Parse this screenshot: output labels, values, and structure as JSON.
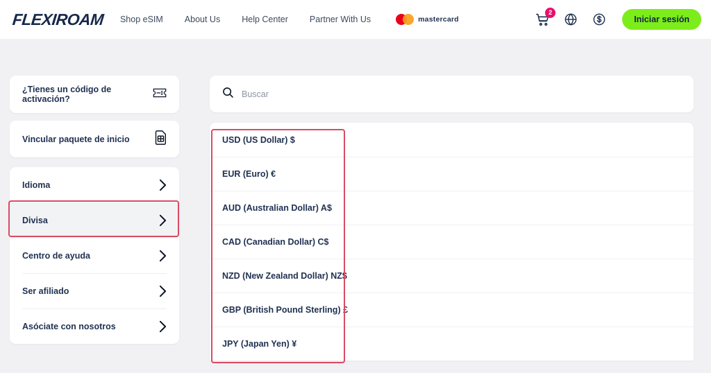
{
  "brand": {
    "logo_text": "FLEXIROAM",
    "accent_green": "#7ced1a",
    "navy": "#1f3050",
    "badge_pink": "#ec0d6e",
    "annotation_red": "#d94a63"
  },
  "header": {
    "nav": [
      {
        "label": "Shop eSIM"
      },
      {
        "label": "About Us"
      },
      {
        "label": "Help Center"
      },
      {
        "label": "Partner With Us"
      }
    ],
    "mastercard_label": "mastercard",
    "cart_count": "2",
    "cart_icon": "shopping-cart-icon",
    "language_icon": "globe-icon",
    "currency_icon": "dollar-circle-icon",
    "login_label": "Iniciar sesión"
  },
  "sidebar": {
    "promos": [
      {
        "label": "¿Tienes un código de activación?",
        "icon": "voucher-ticket-icon"
      },
      {
        "label": "Vincular paquete de inicio",
        "icon": "sim-card-icon"
      }
    ],
    "menu": [
      {
        "label": "Idioma",
        "active": false
      },
      {
        "label": "Divisa",
        "active": true
      },
      {
        "label": "Centro de ayuda",
        "active": false
      },
      {
        "label": "Ser afiliado",
        "active": false
      },
      {
        "label": "Asóciate con nosotros",
        "active": false
      }
    ]
  },
  "main": {
    "search": {
      "placeholder": "Buscar",
      "value": "",
      "icon": "search-icon"
    },
    "currencies": [
      {
        "label": "USD (US Dollar) $"
      },
      {
        "label": "EUR (Euro) €"
      },
      {
        "label": "AUD (Australian Dollar) A$"
      },
      {
        "label": "CAD (Canadian Dollar) C$"
      },
      {
        "label": "NZD (New Zealand Dollar) NZ$"
      },
      {
        "label": "GBP (British Pound Sterling) £"
      },
      {
        "label": "JPY (Japan Yen) ¥"
      }
    ]
  }
}
